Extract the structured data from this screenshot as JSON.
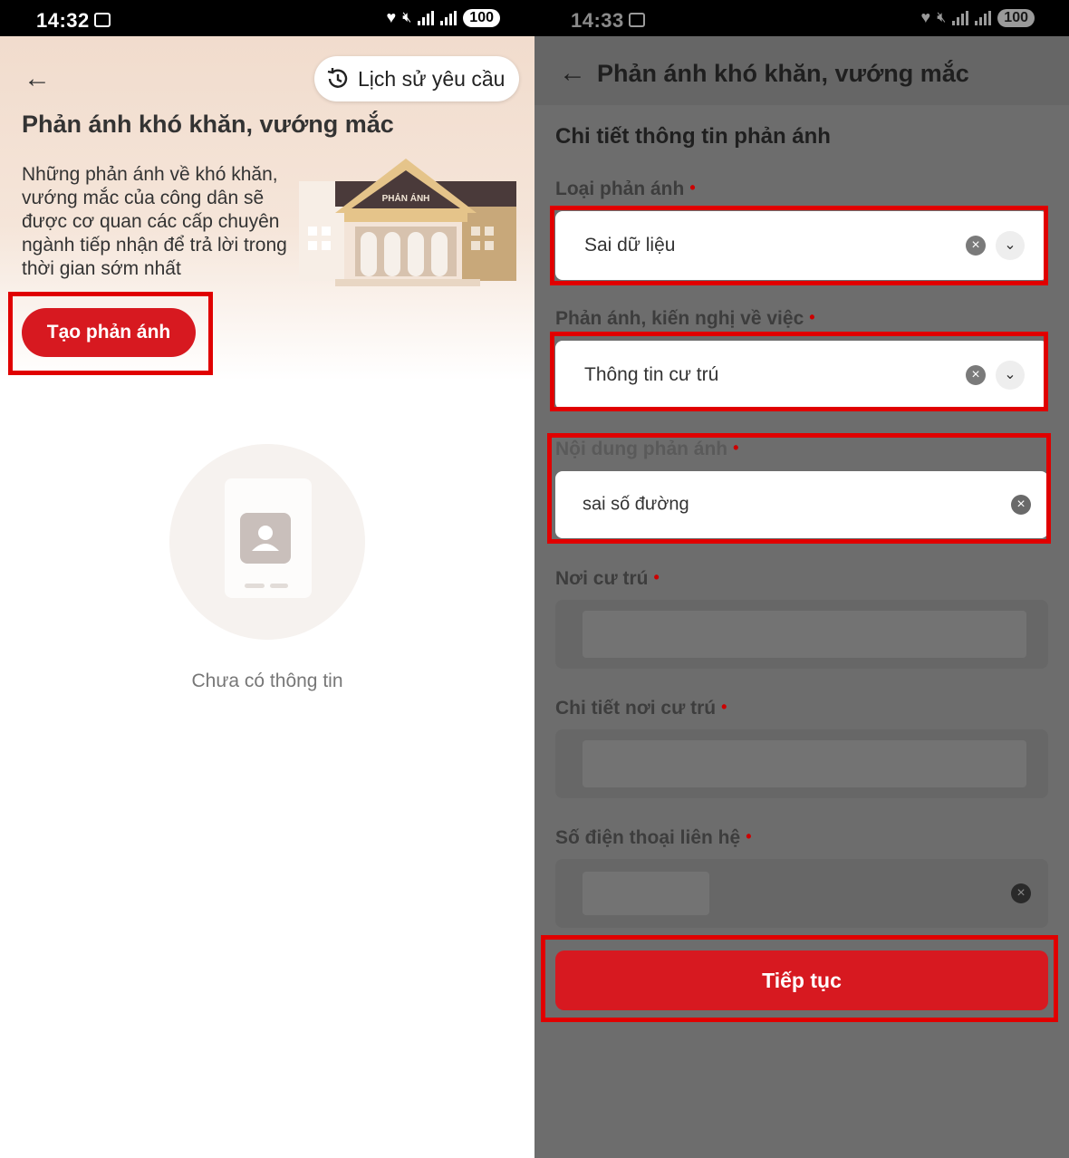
{
  "left": {
    "status_time": "14:32",
    "battery": "100",
    "history_button": "Lịch sử yêu cầu",
    "title": "Phản ánh khó khăn, vướng mắc",
    "description": "Những phản ánh về khó khăn, vướng mắc của công dân sẽ được cơ quan các cấp chuyên ngành tiếp nhận để trả lời trong thời gian sớm nhất",
    "illustration_sign": "PHẢN ÁNH",
    "create_button": "Tạo phản ánh",
    "empty_text": "Chưa có thông tin"
  },
  "right": {
    "status_time": "14:33",
    "battery": "100",
    "title": "Phản ánh khó khăn, vướng mắc",
    "section_title": "Chi tiết thông tin phản ánh",
    "fields": {
      "type_label": "Loại phản ánh",
      "type_value": "Sai dữ liệu",
      "subject_label": "Phản ánh, kiến nghị về việc",
      "subject_value": "Thông tin cư trú",
      "content_label": "Nội dung phản ánh",
      "content_value": "sai số đường",
      "residence_label": "Nơi cư trú",
      "residence_detail_label": "Chi tiết nơi cư trú",
      "phone_label": "Số điện thoại liên hệ"
    },
    "continue_button": "Tiếp tục"
  },
  "icons": {
    "back": "arrow-left-icon",
    "history": "history-clock-icon",
    "clear": "clear-x-icon",
    "dropdown": "chevron-down-icon"
  },
  "colors": {
    "brand_red": "#d71920",
    "highlight_red": "#e00000",
    "overlay": "#6d6d6d"
  }
}
